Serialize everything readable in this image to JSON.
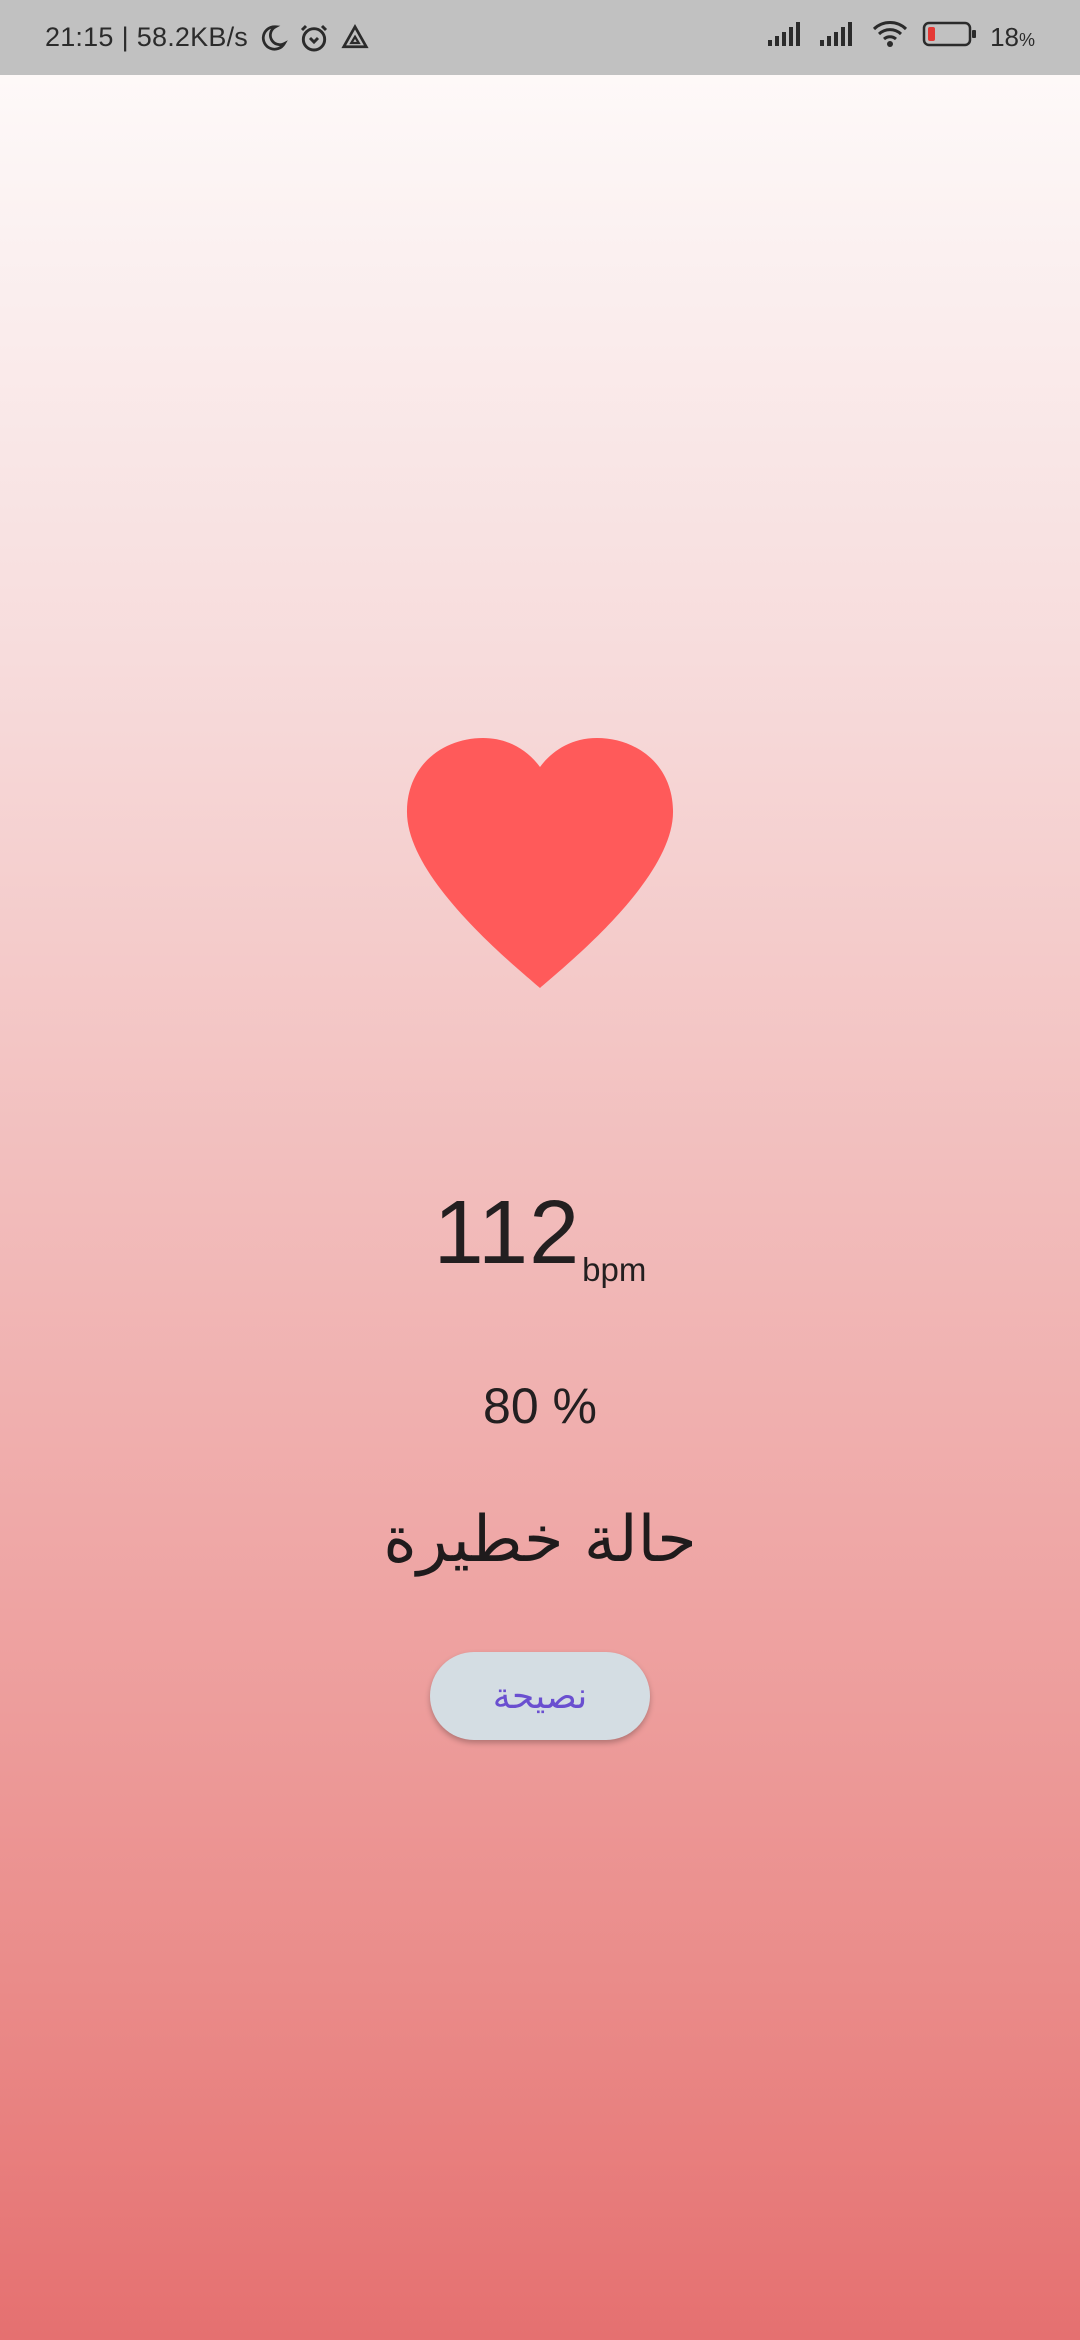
{
  "status_bar": {
    "time": "21:15",
    "separator": "|",
    "speed": "58.2KB/s",
    "battery": "18",
    "battery_unit": "%",
    "icons": [
      "moon-icon",
      "alarm-icon",
      "drive-icon",
      "signal-icon",
      "signal-icon",
      "wifi-icon",
      "battery-icon"
    ],
    "battery_level": 0.18,
    "battery_color": "#e53935"
  },
  "heart": {
    "icon": "heart-icon",
    "color": "#ff5a5a"
  },
  "reading": {
    "bpm_value": "112",
    "bpm_unit": "bpm",
    "percent": "80 %"
  },
  "condition": {
    "label": "حالة خطيرة"
  },
  "advice_button": {
    "label": "نصيحة"
  }
}
